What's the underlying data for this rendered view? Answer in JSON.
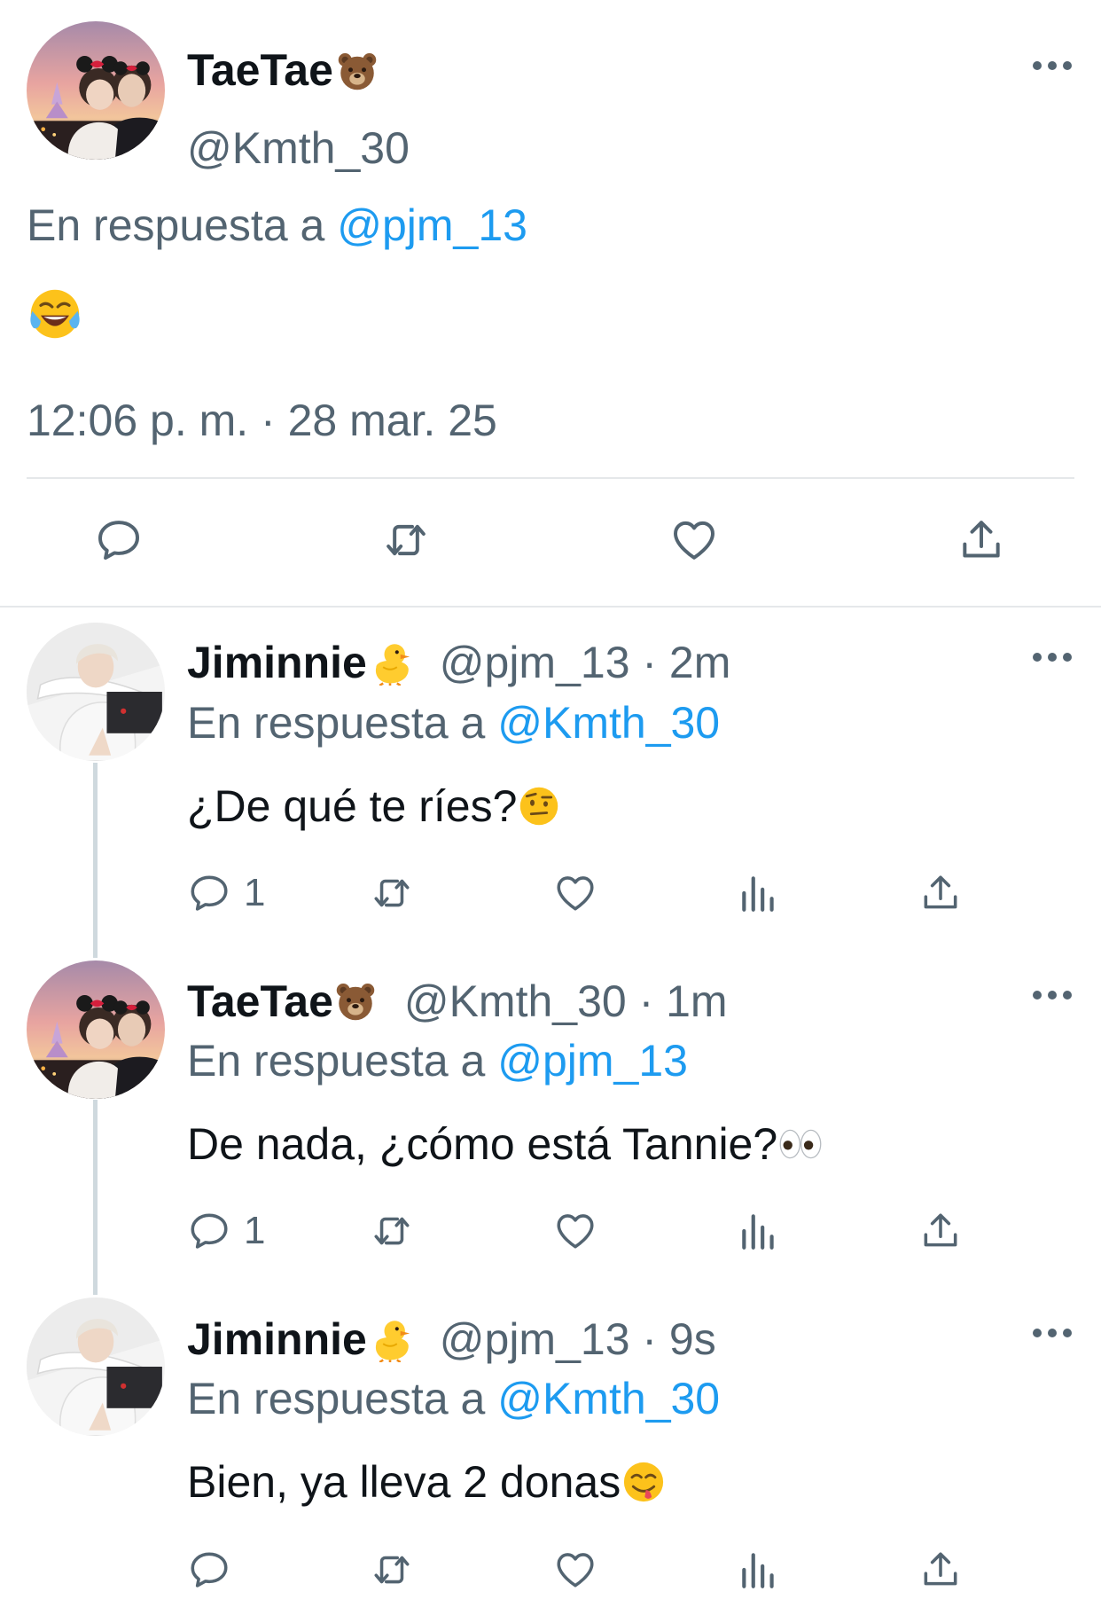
{
  "main_tweet": {
    "name": "TaeTae",
    "name_emoji": "bear-face",
    "handle": "@Kmth_30",
    "reply_prefix": "En respuesta a",
    "reply_to": "@pjm_13",
    "body_emoji": "face-with-tears-of-joy",
    "timestamp": "12:06 p. m. · 28 mar. 25",
    "actions": [
      "reply-icon",
      "retweet-icon",
      "like-icon",
      "share-icon"
    ]
  },
  "replies": [
    {
      "name": "Jiminnie",
      "name_emoji": "hatching-chick",
      "handle": "@pjm_13",
      "meta": "@pjm_13 · 2m",
      "reply_prefix": "En respuesta a",
      "reply_to": "@Kmth_30",
      "body": "¿De qué te ríes?",
      "body_emoji": "face-with-raised-eyebrow",
      "reply_count": "1"
    },
    {
      "name": "TaeTae",
      "name_emoji": "bear-face",
      "handle": "@Kmth_30",
      "meta": "@Kmth_30 · 1m",
      "reply_prefix": "En respuesta a",
      "reply_to": "@pjm_13",
      "body": "De nada, ¿cómo está Tannie?",
      "body_emoji": "eyes",
      "reply_count": "1"
    },
    {
      "name": "Jiminnie",
      "name_emoji": "hatching-chick",
      "handle": "@pjm_13",
      "meta": "@pjm_13 · 9s",
      "reply_prefix": "En respuesta a",
      "reply_to": "@Kmth_30",
      "body": "Bien, ya lleva 2 donas",
      "body_emoji": "face-savoring-food",
      "reply_count": ""
    }
  ],
  "colors": {
    "text_primary": "#0f1419",
    "text_secondary": "#536471",
    "link": "#1d9bf0",
    "divider": "#e5e8ea",
    "thread_line": "#cfd9de"
  }
}
